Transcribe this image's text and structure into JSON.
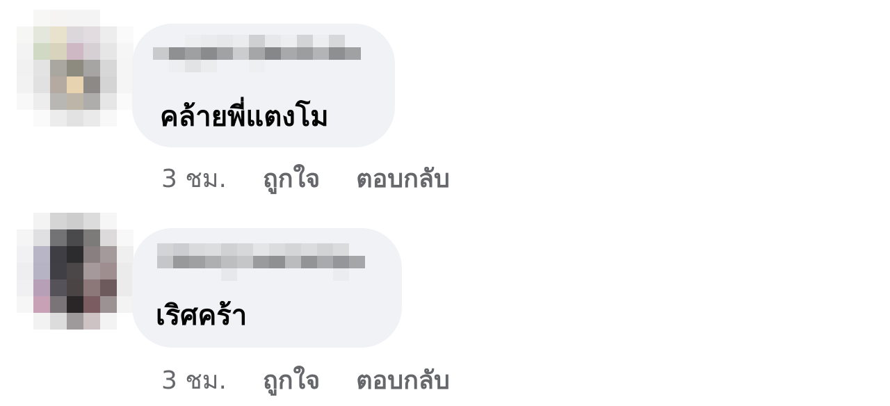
{
  "comments": [
    {
      "text": "คล้ายพี่แตงโม",
      "time": "3 ชม.",
      "like_label": "ถูกใจ",
      "reply_label": "ตอบกลับ"
    },
    {
      "text": "เริศคร้า",
      "time": "3 ชม.",
      "like_label": "ถูกใจ",
      "reply_label": "ตอบกลับ"
    }
  ],
  "colors": {
    "bubble": "#f0f2f5",
    "secondary_text": "#65676b",
    "primary_text": "#050505"
  }
}
